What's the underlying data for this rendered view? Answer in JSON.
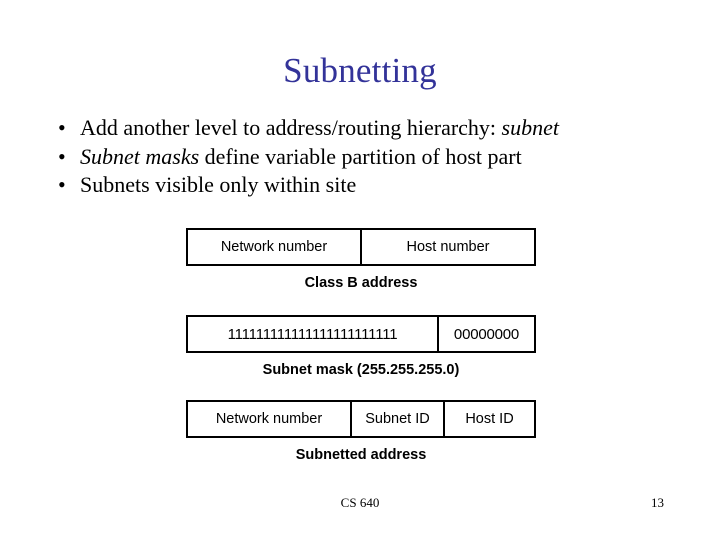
{
  "slide": {
    "title": "Subnetting",
    "title_color": "#333399",
    "bullet_marker": "•",
    "bullets": [
      {
        "prefix": "Add another level to address/routing hierarchy: ",
        "italic": "subnet",
        "suffix": ""
      },
      {
        "prefix": "",
        "italic": "Subnet masks",
        "suffix": " define variable partition of host part"
      },
      {
        "prefix": "Subnets visible only within site",
        "italic": "",
        "suffix": ""
      }
    ],
    "diagrams": [
      {
        "name": "class-b-address",
        "cells": [
          "Network number",
          "Host number"
        ],
        "caption": "Class B address"
      },
      {
        "name": "subnet-mask",
        "cells": [
          "111111111111111111111111",
          "00000000"
        ],
        "caption": "Subnet mask (255.255.255.0)"
      },
      {
        "name": "subnetted-address",
        "cells": [
          "Network number",
          "Subnet ID",
          "Host ID"
        ],
        "caption": "Subnetted address"
      }
    ],
    "footer": {
      "course": "CS 640",
      "page_number": "13"
    }
  }
}
